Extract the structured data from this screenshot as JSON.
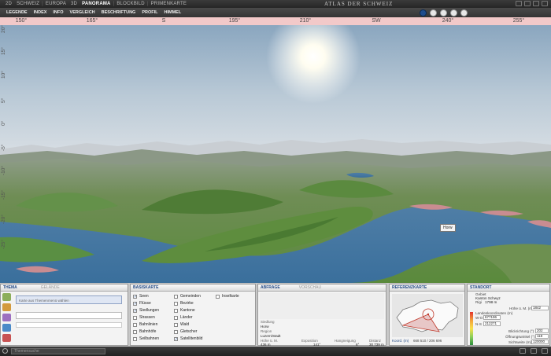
{
  "topbar": {
    "nav": [
      "2D",
      "SCHWEIZ",
      "EUROPA",
      "3D",
      "PANORAMA",
      "BLOCKBILD",
      "PRIMENKARTE"
    ],
    "active": "PANORAMA",
    "brand": "ATLAS DER SCHWEIZ"
  },
  "menubar": {
    "items": [
      "LEGENDE",
      "INDEX",
      "INFO",
      "VERGLEICH",
      "BESCHRIFTUNG",
      "PROFIL",
      "HIMMEL"
    ]
  },
  "compass": {
    "labels": [
      "150°",
      "165°",
      "S",
      "195°",
      "210°",
      "SW",
      "240°",
      "255°"
    ]
  },
  "elevation": {
    "labels": [
      "20°",
      "15°",
      "10°",
      "5°",
      "0°",
      "-5°",
      "-10°",
      "-15°",
      "-20°",
      "-25°"
    ]
  },
  "view": {
    "tooltip": "Horw"
  },
  "thema": {
    "tabs": [
      "THEMA",
      "GELÄNDE"
    ],
    "placeholder": "Karte aus Themenmenü wählen"
  },
  "basiskarte": {
    "title": "BASISKARTE",
    "col1": [
      {
        "label": "Seen",
        "checked": true
      },
      {
        "label": "Flüsse",
        "checked": true
      },
      {
        "label": "Siedlungen",
        "checked": true
      },
      {
        "label": "Strassen",
        "checked": false
      },
      {
        "label": "Bahnlinien",
        "checked": false
      },
      {
        "label": "Bahnhöfe",
        "checked": false
      },
      {
        "label": "Seilbahnen",
        "checked": false
      }
    ],
    "col2": [
      {
        "label": "Gemeinden",
        "checked": false
      },
      {
        "label": "Bezirke",
        "checked": false
      },
      {
        "label": "Kantone",
        "checked": false
      },
      {
        "label": "Länder",
        "checked": false
      },
      {
        "label": "Wald",
        "checked": false
      },
      {
        "label": "Gletscher",
        "checked": false
      },
      {
        "label": "Satellitenbild",
        "checked": true
      }
    ],
    "col3": [
      {
        "label": "Inselkarte",
        "checked": false
      }
    ]
  },
  "abfrage": {
    "tabs": [
      "ABFRAGE",
      "VORSCHAU"
    ],
    "siedlung_label": "Siedlung",
    "siedlung_value": "Horw",
    "region_label": "Region",
    "region_value": "Luzern/Stadt",
    "hoehe_label": "Höhe ü. M.",
    "hoehe_value": "436 m",
    "exposition_label": "Exposition",
    "exposition_value": "141°",
    "neigung_label": "Hangneigung",
    "neigung_value": "6°",
    "distanz_label": "Distanz",
    "distanz_value": "30 739 m"
  },
  "referenzkarte": {
    "title": "REFERENZKARTE",
    "koord_label": "Koord. (m)",
    "koord_value": "668 510 / 206 696"
  },
  "standort": {
    "title": "STANDORT",
    "gebiet_label": "Gebiet",
    "gebiet_value": "Kanton Schwyz",
    "rigi_label": "Rigi",
    "rigi_value": "1798 m",
    "hoehe_label": "Höhe ü. M. (m)",
    "hoehe_value": "1842",
    "landes_label": "Landeskoordinaten (m)",
    "wo_label": "W-O",
    "wo_value": "677196",
    "ns_label": "N-S",
    "ns_value": "212271",
    "blick_label": "Blickrichtung (°)",
    "blick_value": "202",
    "oeffnung_label": "Öffnungswinkel (°)",
    "oeffnung_value": "118",
    "sicht_label": "Sichtweite (m)",
    "sicht_value": "120000"
  },
  "search": {
    "placeholder": "Themensuche"
  }
}
